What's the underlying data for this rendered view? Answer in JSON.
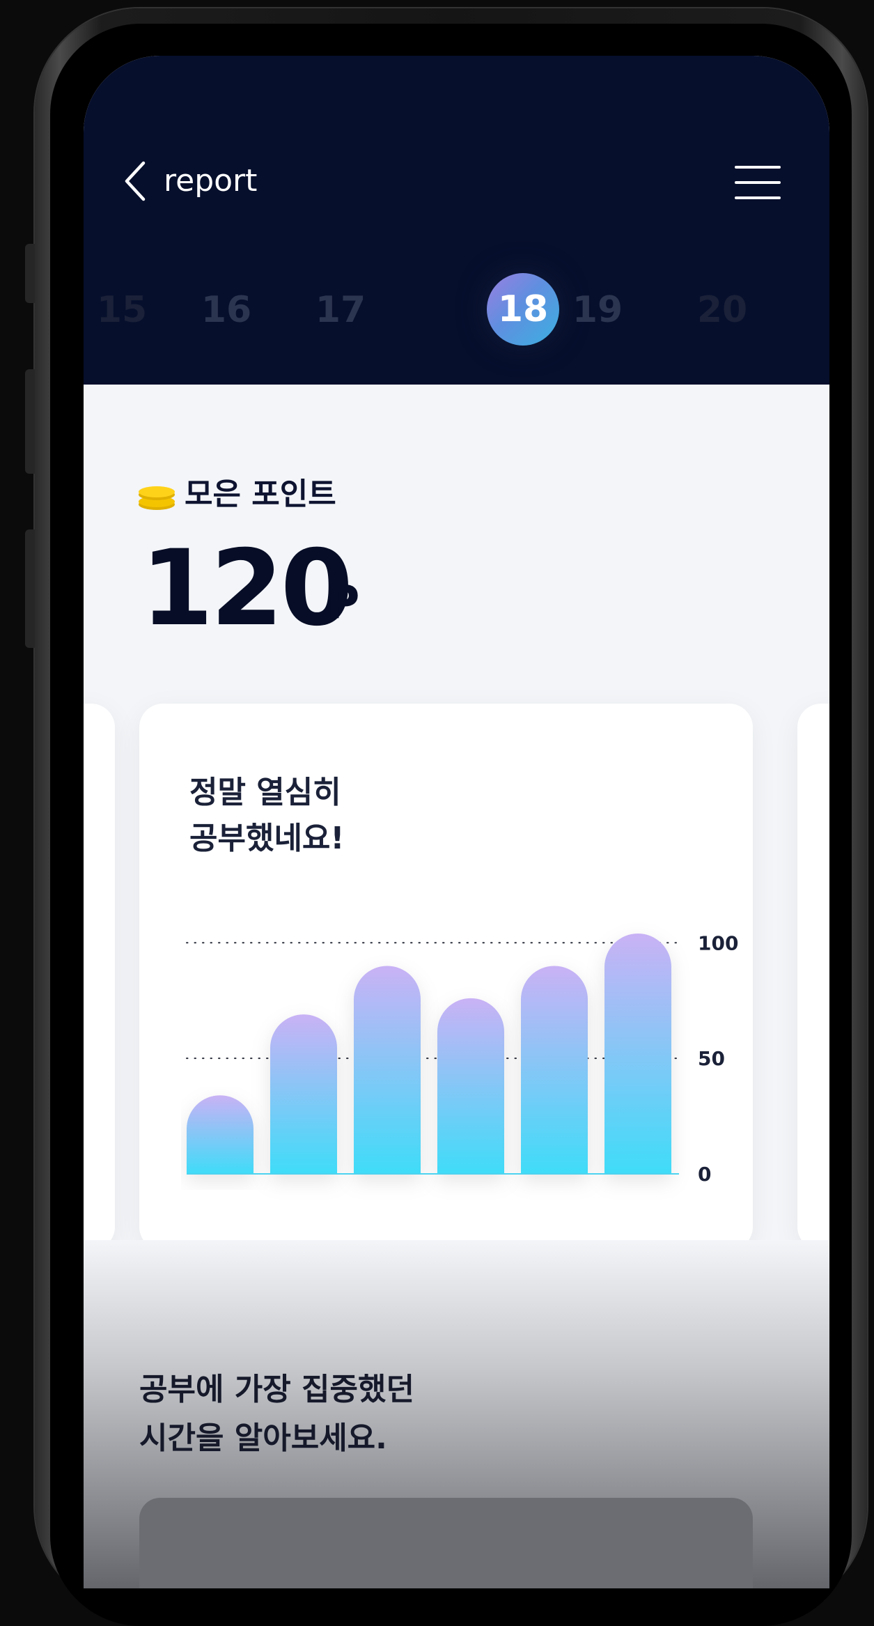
{
  "header": {
    "back_icon": "chevron-left-icon",
    "title": "report",
    "menu_icon": "hamburger-menu-icon"
  },
  "date_strip": {
    "dates": [
      "15",
      "16",
      "17",
      "18",
      "19",
      "20"
    ],
    "selected": "18"
  },
  "points": {
    "icon": "coin-stack-icon",
    "label": "모은 포인트",
    "value": "120",
    "unit": "P"
  },
  "card": {
    "title": "정말 열심히\n공부했네요!"
  },
  "chart_data": {
    "type": "bar",
    "categories": [
      "",
      "",
      "",
      "",
      "",
      ""
    ],
    "values": [
      34,
      69,
      90,
      76,
      90,
      104
    ],
    "yticks": [
      "100",
      "50",
      "0"
    ],
    "ylim": [
      0,
      104
    ],
    "grid": "dotted",
    "colors": {
      "top": "#c9b2f5",
      "bottom": "#3fdcf8"
    }
  },
  "focus_section": {
    "text": "공부에 가장 집중했던\n시간을 알아보세요."
  },
  "colors": {
    "header_bg": "#060f2c",
    "screen_bg": "#f3f5f8",
    "accent_gradient_start": "#9b7fe0",
    "accent_gradient_end": "#3bb0e0",
    "coin": "#f5c400"
  }
}
